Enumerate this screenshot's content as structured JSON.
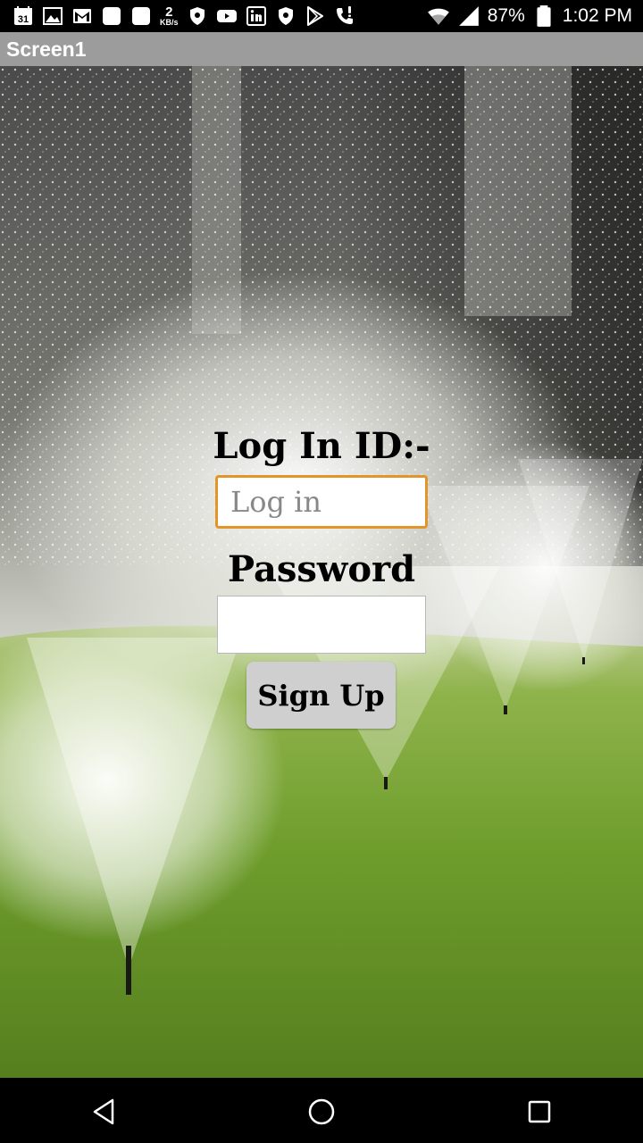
{
  "status_bar": {
    "calendar_day": "31",
    "net_speed_value": "2",
    "net_speed_unit": "KB/s",
    "battery": "87%",
    "time": "1:02 PM",
    "left_icons": [
      "calendar-icon",
      "gallery-icon",
      "gmail-icon",
      "app-square-icon",
      "app-square-icon",
      "net-speed-icon",
      "vpn-shield-icon",
      "youtube-icon",
      "linkedin-icon",
      "vpn-shield-icon",
      "play-store-icon",
      "call-alert-icon"
    ],
    "right_icons": [
      "wifi-icon",
      "signal-icon"
    ]
  },
  "app": {
    "title": "Screen1"
  },
  "form": {
    "login_label": "Log In ID:-",
    "login_placeholder": "Log in",
    "login_value": "",
    "password_label": "Password",
    "password_value": "",
    "signup_label": "Sign Up",
    "login_focus_color": "#e3952a",
    "button_color": "#cfcfcf"
  },
  "background": {
    "description_icon": "lawn-sprinkler-photo"
  },
  "nav_bar": {
    "buttons": [
      "back-icon",
      "home-icon",
      "recents-icon"
    ]
  }
}
